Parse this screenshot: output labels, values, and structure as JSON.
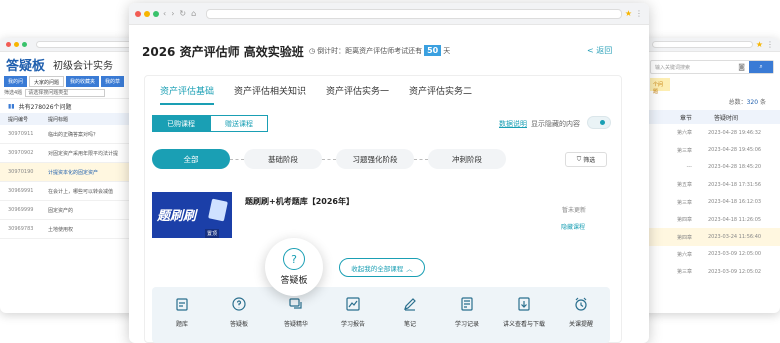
{
  "left_window": {
    "logo": "答疑板",
    "subject": "初级会计实务",
    "tabs": [
      "我的问",
      "大家的问题",
      "我的收藏夹",
      "我的草"
    ],
    "filter_label": "筛选4题",
    "filter_value": "请选择搜问题类型",
    "total": "共有278026个问题",
    "columns": [
      "提问编号",
      "提问标题"
    ],
    "rows": [
      {
        "id": "30970911",
        "title": "临出的正确答案对吗？"
      },
      {
        "id": "30970902",
        "title": "对固定资产采用年限平均法计提"
      },
      {
        "id": "30970190",
        "title": "计提资本化的固定资产"
      },
      {
        "id": "30969991",
        "title": "在会计上，哪些可以转会减值"
      },
      {
        "id": "30969999",
        "title": "固定资产的"
      },
      {
        "id": "30969783",
        "title": "土地使用权"
      }
    ]
  },
  "right_window": {
    "search_placeholder": "输入关键词搜索",
    "yellow_tag": "个问题",
    "total_label": "总数：",
    "total_value": "320",
    "total_unit": "条",
    "columns": [
      "章节",
      "答疑时间"
    ],
    "rows": [
      {
        "chapter": "第六章",
        "time": "2023-04-28 19:46:32"
      },
      {
        "chapter": "第三章",
        "time": "2023-04-28 19:45:06"
      },
      {
        "chapter": "---",
        "time": "2023-04-28 18:45:20"
      },
      {
        "chapter": "第五章",
        "time": "2023-04-18 17:31:56"
      },
      {
        "chapter": "第三章",
        "time": "2023-04-18 16:12:03"
      },
      {
        "chapter": "第四章",
        "time": "2023-04-18 11:26:05"
      },
      {
        "chapter": "第四章",
        "time": "2023-03-24 11:56:40"
      },
      {
        "chapter": "第六章",
        "time": "2023-03-09 12:05:00"
      },
      {
        "chapter": "第三章",
        "time": "2023-03-09 12:05:02"
      }
    ]
  },
  "main": {
    "title": "2026 资产评估师 高效实验班",
    "countdown_prefix": "倒计时：距离资产评估师考试还有",
    "countdown_days": "50",
    "countdown_suffix": "天",
    "back": "< 返回",
    "tabs": [
      "资产评估基础",
      "资产评估相关知识",
      "资产评估实务一",
      "资产评估实务二"
    ],
    "segments": [
      "已购课程",
      "赠送课程"
    ],
    "data_link": "数据说明",
    "hide_label": "显示隐藏的内容",
    "stages": [
      "全部",
      "基础阶段",
      "习题强化阶段",
      "冲刺阶段"
    ],
    "filter": "筛选",
    "cover_title": "题刷刷",
    "cover_tag": "置顶",
    "course_name": "题刷刷+机考题库【2026年】",
    "no_update": "暂未更新",
    "hide_course": "隐藏课程",
    "collapse": "收起我的全部课程",
    "bubble_label": "答疑板",
    "tools": [
      "题库",
      "答疑板",
      "答疑精华",
      "学习报告",
      "笔记",
      "学习记录",
      "讲义查看与下载",
      "关课提醒"
    ]
  }
}
